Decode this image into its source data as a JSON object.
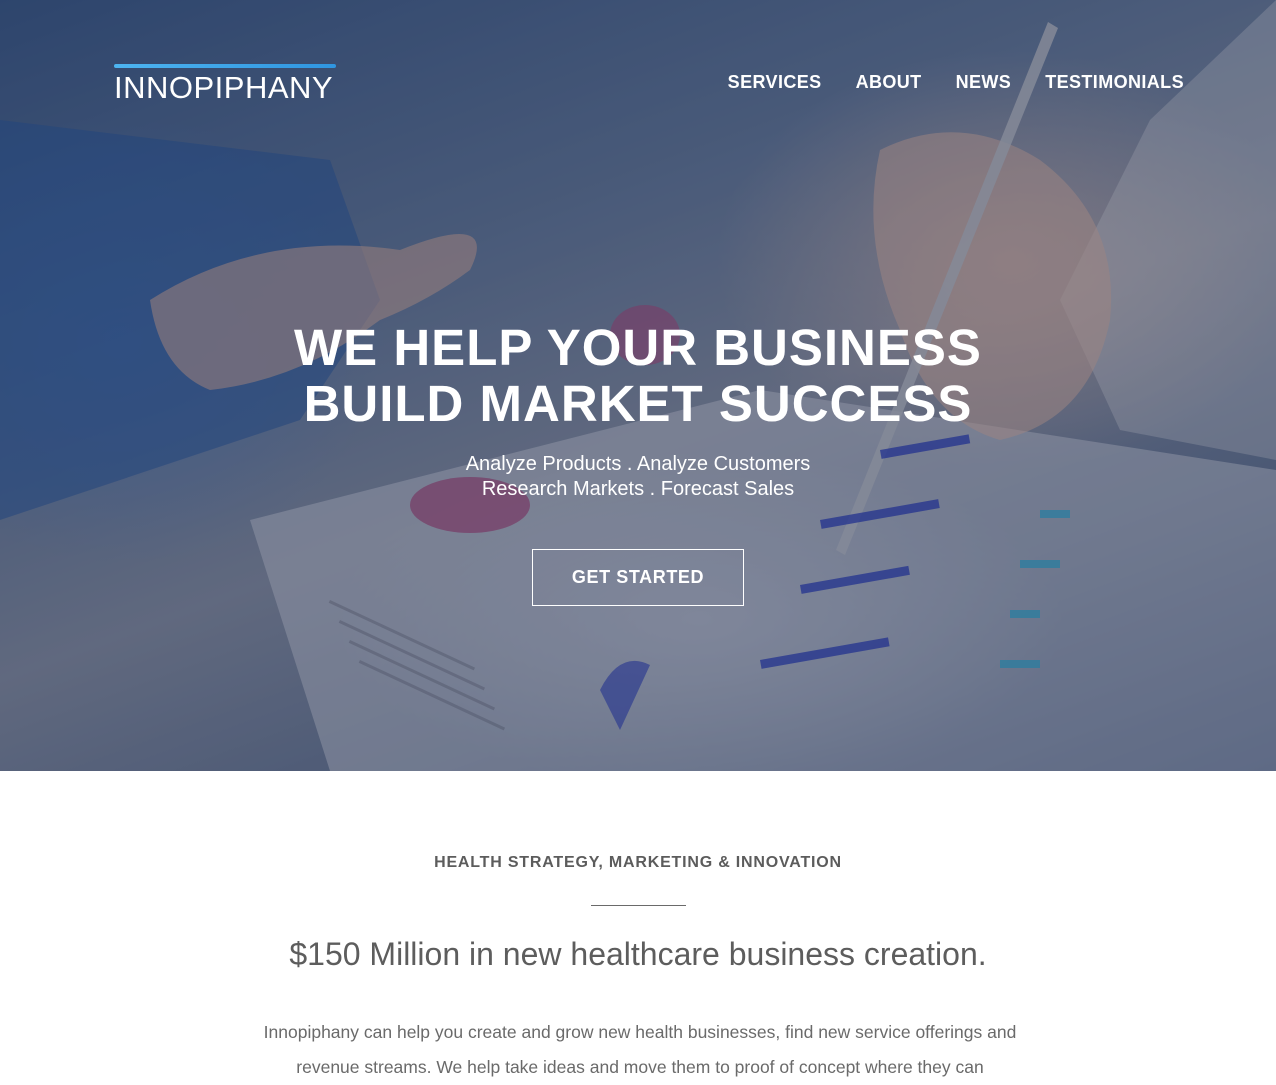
{
  "brand": {
    "name": "INNOPIPHANY",
    "accent_color": "#3aa6ea"
  },
  "nav": {
    "items": [
      "SERVICES",
      "ABOUT",
      "NEWS",
      "TESTIMONIALS"
    ]
  },
  "hero": {
    "title_line1": "WE HELP YOUR BUSINESS",
    "title_line2": "BUILD MARKET SUCCESS",
    "subtitle_line1": "Analyze Products . Analyze Customers",
    "subtitle_line2": "Research Markets . Forecast Sales",
    "cta_label": "GET STARTED"
  },
  "section": {
    "kicker": "HEALTH STRATEGY, MARKETING & INNOVATION",
    "headline": "$150 Million in new healthcare business creation.",
    "body": "Innopiphany can help you create and grow new health businesses, find new service offerings and revenue streams. We help take ideas and move them to proof of concept where they can"
  }
}
